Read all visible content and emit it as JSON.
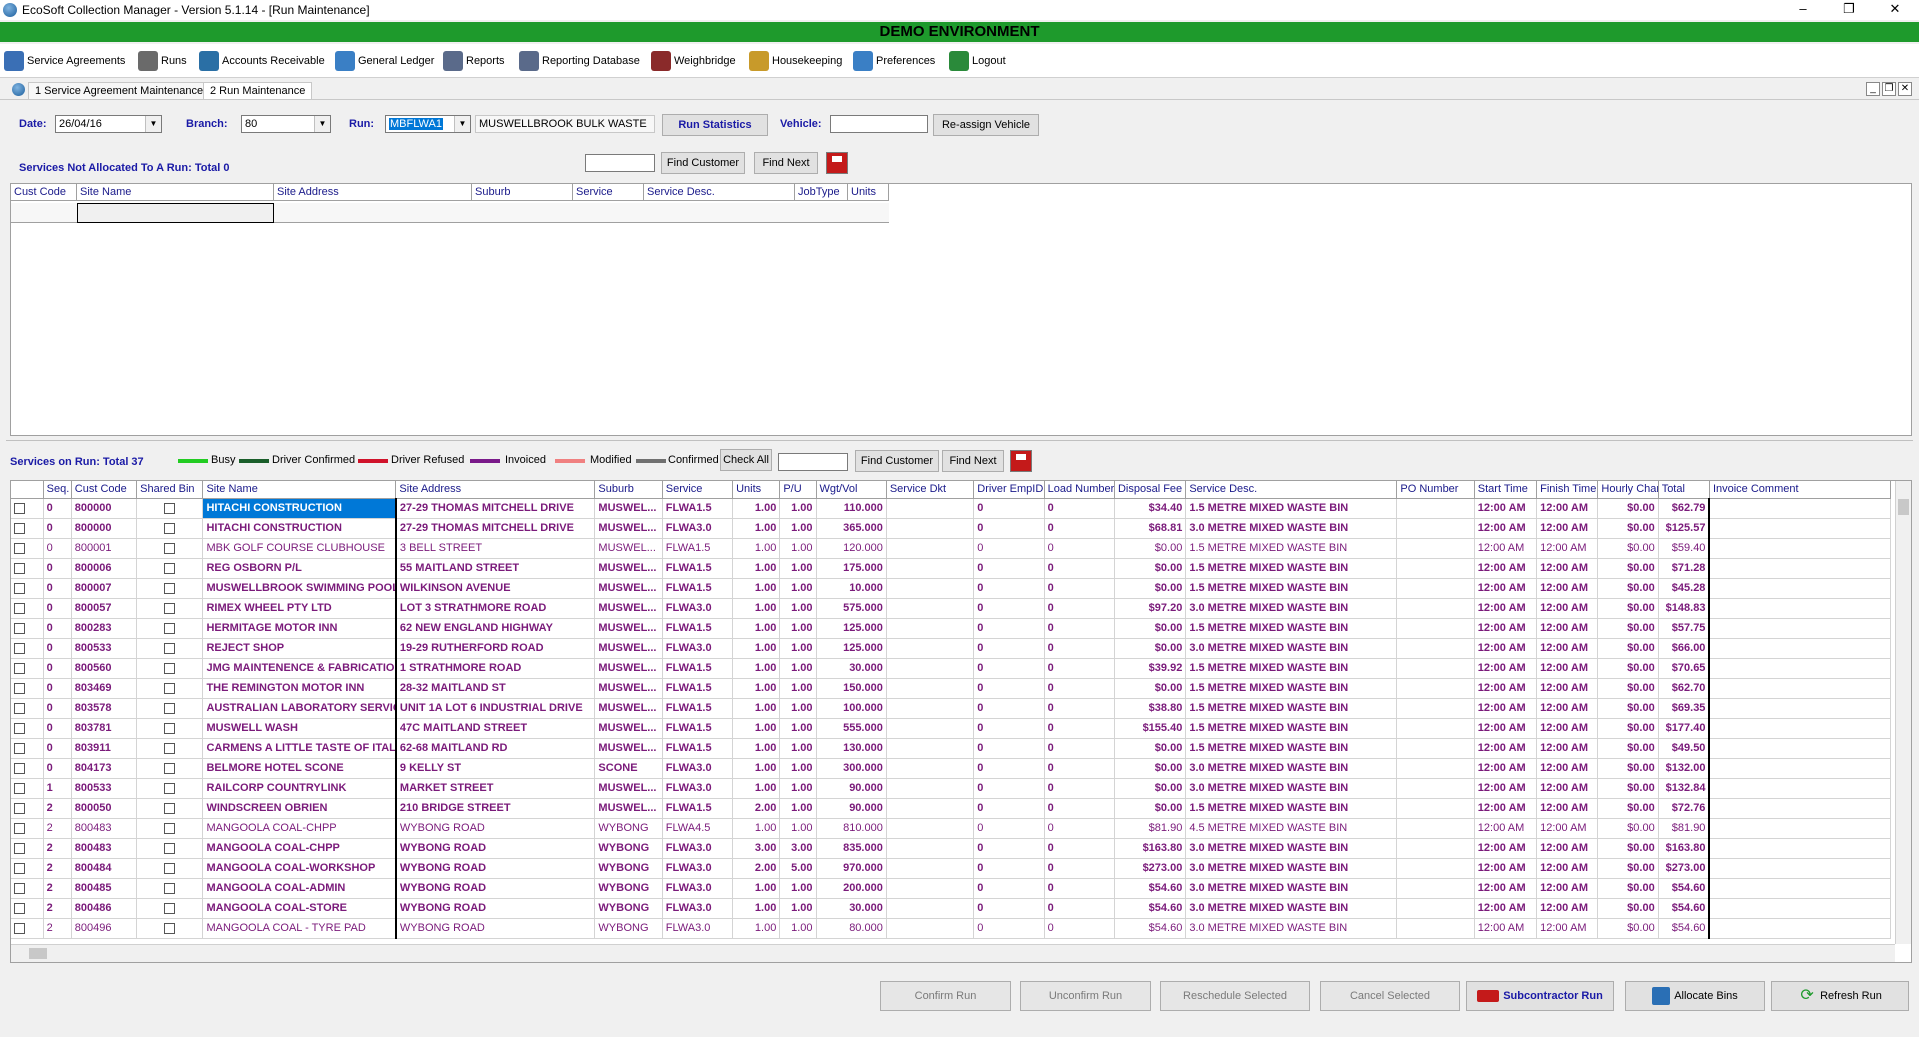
{
  "window": {
    "title": "EcoSoft Collection Manager - Version 5.1.14 - [Run Maintenance]",
    "banner": "DEMO ENVIRONMENT"
  },
  "menu": [
    {
      "label": "Service Agreements",
      "icon": "service-agreements-icon"
    },
    {
      "label": "Runs",
      "icon": "runs-icon"
    },
    {
      "label": "Accounts Receivable",
      "icon": "accounts-receivable-icon"
    },
    {
      "label": "General Ledger",
      "icon": "general-ledger-icon"
    },
    {
      "label": "Reports",
      "icon": "reports-icon"
    },
    {
      "label": "Reporting Database",
      "icon": "reporting-database-icon"
    },
    {
      "label": "Weighbridge",
      "icon": "weighbridge-icon"
    },
    {
      "label": "Housekeeping",
      "icon": "housekeeping-icon"
    },
    {
      "label": "Preferences",
      "icon": "preferences-icon"
    },
    {
      "label": "Logout",
      "icon": "logout-icon"
    }
  ],
  "tabs": [
    "1 Service Agreement Maintenance",
    "2 Run Maintenance"
  ],
  "filters": {
    "date_label": "Date:",
    "date_value": "26/04/16",
    "branch_label": "Branch:",
    "branch_value": "80",
    "run_label": "Run:",
    "run_value": "MBFLWA1",
    "run_desc": "MUSWELLBROOK BULK WASTE",
    "run_stats_label": "Run Statistics",
    "vehicle_label": "Vehicle:",
    "vehicle_value": "",
    "reassign_label": "Re-assign Vehicle"
  },
  "unallocated": {
    "title": "Services Not Allocated To A Run: Total 0",
    "find_customer": "Find Customer",
    "find_next": "Find Next",
    "search_value": "",
    "columns": [
      "Cust Code",
      "Site Name",
      "Site Address",
      "Suburb",
      "Service",
      "Service Desc.",
      "JobType",
      "Units"
    ]
  },
  "on_run": {
    "title": "Services on Run: Total 37",
    "legend": [
      {
        "label": "Busy",
        "color": "#22cc22"
      },
      {
        "label": "Driver Confirmed",
        "color": "#1a5e2a"
      },
      {
        "label": "Driver Refused",
        "color": "#d0122a"
      },
      {
        "label": "Invoiced",
        "color": "#7a1a8a"
      },
      {
        "label": "Modified",
        "color": "#f08080"
      },
      {
        "label": "Confirmed",
        "color": "#707070"
      }
    ],
    "check_all": "Check All",
    "find_customer": "Find Customer",
    "find_next": "Find Next",
    "search_value": "",
    "columns": [
      "Seq.",
      "Cust Code",
      "Shared Bin",
      "Site Name",
      "Site Address",
      "Suburb",
      "Service",
      "Units",
      "P/U",
      "Wgt/Vol",
      "Service Dkt",
      "Driver EmpID",
      "Load Number",
      "Disposal Fee",
      "Service Desc.",
      "PO Number",
      "Start Time",
      "Finish Time",
      "Hourly Charge",
      "Total",
      "Invoice Comment"
    ],
    "rows": [
      {
        "seq": "0",
        "code": "800000",
        "name": "HITACHI CONSTRUCTION",
        "addr": "27-29 THOMAS MITCHELL DRIVE",
        "suburb": "MUSWEL...",
        "service": "FLWA1.5",
        "units": "1.00",
        "pu": "1.00",
        "wgt": "110.000",
        "dkt": "",
        "emp": "0",
        "load": "0",
        "fee": "$34.40",
        "desc": "1.5 METRE MIXED WASTE BIN",
        "po": "",
        "start": "12:00 AM",
        "finish": "12:00 AM",
        "hourly": "$0.00",
        "total": "$62.79",
        "comment": "",
        "bold": true,
        "selected": true
      },
      {
        "seq": "0",
        "code": "800000",
        "name": "HITACHI CONSTRUCTION",
        "addr": "27-29 THOMAS MITCHELL DRIVE",
        "suburb": "MUSWEL...",
        "service": "FLWA3.0",
        "units": "1.00",
        "pu": "1.00",
        "wgt": "365.000",
        "dkt": "",
        "emp": "0",
        "load": "0",
        "fee": "$68.81",
        "desc": "3.0 METRE MIXED WASTE BIN",
        "po": "",
        "start": "12:00 AM",
        "finish": "12:00 AM",
        "hourly": "$0.00",
        "total": "$125.57",
        "comment": "",
        "bold": true
      },
      {
        "seq": "0",
        "code": "800001",
        "name": "MBK GOLF COURSE CLUBHOUSE",
        "addr": "3 BELL STREET",
        "suburb": "MUSWEL...",
        "service": "FLWA1.5",
        "units": "1.00",
        "pu": "1.00",
        "wgt": "120.000",
        "dkt": "",
        "emp": "0",
        "load": "0",
        "fee": "$0.00",
        "desc": "1.5 METRE MIXED WASTE BIN",
        "po": "",
        "start": "12:00 AM",
        "finish": "12:00 AM",
        "hourly": "$0.00",
        "total": "$59.40",
        "comment": "",
        "bold": false
      },
      {
        "seq": "0",
        "code": "800006",
        "name": "REG OSBORN P/L",
        "addr": "55 MAITLAND STREET",
        "suburb": "MUSWEL...",
        "service": "FLWA1.5",
        "units": "1.00",
        "pu": "1.00",
        "wgt": "175.000",
        "dkt": "",
        "emp": "0",
        "load": "0",
        "fee": "$0.00",
        "desc": "1.5 METRE MIXED WASTE BIN",
        "po": "",
        "start": "12:00 AM",
        "finish": "12:00 AM",
        "hourly": "$0.00",
        "total": "$71.28",
        "comment": "",
        "bold": true
      },
      {
        "seq": "0",
        "code": "800007",
        "name": "MUSWELLBROOK SWIMMING POOL",
        "addr": "WILKINSON AVENUE",
        "suburb": "MUSWEL...",
        "service": "FLWA1.5",
        "units": "1.00",
        "pu": "1.00",
        "wgt": "10.000",
        "dkt": "",
        "emp": "0",
        "load": "0",
        "fee": "$0.00",
        "desc": "1.5 METRE MIXED WASTE BIN",
        "po": "",
        "start": "12:00 AM",
        "finish": "12:00 AM",
        "hourly": "$0.00",
        "total": "$45.28",
        "comment": "",
        "bold": true
      },
      {
        "seq": "0",
        "code": "800057",
        "name": "RIMEX WHEEL PTY LTD",
        "addr": "LOT 3 STRATHMORE ROAD",
        "suburb": "MUSWEL...",
        "service": "FLWA3.0",
        "units": "1.00",
        "pu": "1.00",
        "wgt": "575.000",
        "dkt": "",
        "emp": "0",
        "load": "0",
        "fee": "$97.20",
        "desc": "3.0 METRE MIXED WASTE BIN",
        "po": "",
        "start": "12:00 AM",
        "finish": "12:00 AM",
        "hourly": "$0.00",
        "total": "$148.83",
        "comment": "",
        "bold": true
      },
      {
        "seq": "0",
        "code": "800283",
        "name": "HERMITAGE MOTOR INN",
        "addr": "62 NEW ENGLAND HIGHWAY",
        "suburb": "MUSWEL...",
        "service": "FLWA1.5",
        "units": "1.00",
        "pu": "1.00",
        "wgt": "125.000",
        "dkt": "",
        "emp": "0",
        "load": "0",
        "fee": "$0.00",
        "desc": "1.5 METRE MIXED WASTE BIN",
        "po": "",
        "start": "12:00 AM",
        "finish": "12:00 AM",
        "hourly": "$0.00",
        "total": "$57.75",
        "comment": "",
        "bold": true
      },
      {
        "seq": "0",
        "code": "800533",
        "name": "REJECT SHOP",
        "addr": "19-29 RUTHERFORD ROAD",
        "suburb": "MUSWEL...",
        "service": "FLWA3.0",
        "units": "1.00",
        "pu": "1.00",
        "wgt": "125.000",
        "dkt": "",
        "emp": "0",
        "load": "0",
        "fee": "$0.00",
        "desc": "3.0 METRE MIXED WASTE BIN",
        "po": "",
        "start": "12:00 AM",
        "finish": "12:00 AM",
        "hourly": "$0.00",
        "total": "$66.00",
        "comment": "",
        "bold": true
      },
      {
        "seq": "0",
        "code": "800560",
        "name": "JMG MAINTENENCE & FABRICATIO",
        "addr": "1 STRATHMORE ROAD",
        "suburb": "MUSWEL...",
        "service": "FLWA1.5",
        "units": "1.00",
        "pu": "1.00",
        "wgt": "30.000",
        "dkt": "",
        "emp": "0",
        "load": "0",
        "fee": "$39.92",
        "desc": "1.5 METRE MIXED WASTE BIN",
        "po": "",
        "start": "12:00 AM",
        "finish": "12:00 AM",
        "hourly": "$0.00",
        "total": "$70.65",
        "comment": "",
        "bold": true
      },
      {
        "seq": "0",
        "code": "803469",
        "name": "THE REMINGTON MOTOR INN",
        "addr": "28-32 MAITLAND ST",
        "suburb": "MUSWEL...",
        "service": "FLWA1.5",
        "units": "1.00",
        "pu": "1.00",
        "wgt": "150.000",
        "dkt": "",
        "emp": "0",
        "load": "0",
        "fee": "$0.00",
        "desc": "1.5 METRE MIXED WASTE BIN",
        "po": "",
        "start": "12:00 AM",
        "finish": "12:00 AM",
        "hourly": "$0.00",
        "total": "$62.70",
        "comment": "",
        "bold": true
      },
      {
        "seq": "0",
        "code": "803578",
        "name": "AUSTRALIAN LABORATORY SERVIC",
        "addr": "UNIT 1A LOT 6 INDUSTRIAL DRIVE",
        "suburb": "MUSWEL...",
        "service": "FLWA1.5",
        "units": "1.00",
        "pu": "1.00",
        "wgt": "100.000",
        "dkt": "",
        "emp": "0",
        "load": "0",
        "fee": "$38.80",
        "desc": "1.5 METRE MIXED WASTE BIN",
        "po": "",
        "start": "12:00 AM",
        "finish": "12:00 AM",
        "hourly": "$0.00",
        "total": "$69.35",
        "comment": "",
        "bold": true
      },
      {
        "seq": "0",
        "code": "803781",
        "name": "MUSWELL WASH",
        "addr": "47C MAITLAND  STREET",
        "suburb": "MUSWEL...",
        "service": "FLWA1.5",
        "units": "1.00",
        "pu": "1.00",
        "wgt": "555.000",
        "dkt": "",
        "emp": "0",
        "load": "0",
        "fee": "$155.40",
        "desc": "1.5 METRE MIXED WASTE BIN",
        "po": "",
        "start": "12:00 AM",
        "finish": "12:00 AM",
        "hourly": "$0.00",
        "total": "$177.40",
        "comment": "",
        "bold": true
      },
      {
        "seq": "0",
        "code": "803911",
        "name": "CARMENS A LITTLE TASTE OF ITAL",
        "addr": "62-68 MAITLAND RD",
        "suburb": "MUSWEL...",
        "service": "FLWA1.5",
        "units": "1.00",
        "pu": "1.00",
        "wgt": "130.000",
        "dkt": "",
        "emp": "0",
        "load": "0",
        "fee": "$0.00",
        "desc": "1.5 METRE MIXED WASTE BIN",
        "po": "",
        "start": "12:00 AM",
        "finish": "12:00 AM",
        "hourly": "$0.00",
        "total": "$49.50",
        "comment": "",
        "bold": true
      },
      {
        "seq": "0",
        "code": "804173",
        "name": "BELMORE HOTEL SCONE",
        "addr": "9 KELLY ST",
        "suburb": "SCONE",
        "service": "FLWA3.0",
        "units": "1.00",
        "pu": "1.00",
        "wgt": "300.000",
        "dkt": "",
        "emp": "0",
        "load": "0",
        "fee": "$0.00",
        "desc": "3.0 METRE MIXED WASTE BIN",
        "po": "",
        "start": "12:00 AM",
        "finish": "12:00 AM",
        "hourly": "$0.00",
        "total": "$132.00",
        "comment": "",
        "bold": true
      },
      {
        "seq": "1",
        "code": "800533",
        "name": "RAILCORP COUNTRYLINK",
        "addr": "MARKET STREET",
        "suburb": "MUSWEL...",
        "service": "FLWA3.0",
        "units": "1.00",
        "pu": "1.00",
        "wgt": "90.000",
        "dkt": "",
        "emp": "0",
        "load": "0",
        "fee": "$0.00",
        "desc": "3.0 METRE MIXED WASTE BIN",
        "po": "",
        "start": "12:00 AM",
        "finish": "12:00 AM",
        "hourly": "$0.00",
        "total": "$132.84",
        "comment": "",
        "bold": true
      },
      {
        "seq": "2",
        "code": "800050",
        "name": "WINDSCREEN OBRIEN",
        "addr": "210 BRIDGE STREET",
        "suburb": "MUSWEL...",
        "service": "FLWA1.5",
        "units": "2.00",
        "pu": "1.00",
        "wgt": "90.000",
        "dkt": "",
        "emp": "0",
        "load": "0",
        "fee": "$0.00",
        "desc": "1.5 METRE MIXED WASTE BIN",
        "po": "",
        "start": "12:00 AM",
        "finish": "12:00 AM",
        "hourly": "$0.00",
        "total": "$72.76",
        "comment": "",
        "bold": true
      },
      {
        "seq": "2",
        "code": "800483",
        "name": "MANGOOLA COAL-CHPP",
        "addr": "WYBONG ROAD",
        "suburb": "WYBONG",
        "service": "FLWA4.5",
        "units": "1.00",
        "pu": "1.00",
        "wgt": "810.000",
        "dkt": "",
        "emp": "0",
        "load": "0",
        "fee": "$81.90",
        "desc": "4.5 METRE MIXED WASTE BIN",
        "po": "",
        "start": "12:00 AM",
        "finish": "12:00 AM",
        "hourly": "$0.00",
        "total": "$81.90",
        "comment": "",
        "bold": false
      },
      {
        "seq": "2",
        "code": "800483",
        "name": "MANGOOLA COAL-CHPP",
        "addr": "WYBONG ROAD",
        "suburb": "WYBONG",
        "service": "FLWA3.0",
        "units": "3.00",
        "pu": "3.00",
        "wgt": "835.000",
        "dkt": "",
        "emp": "0",
        "load": "0",
        "fee": "$163.80",
        "desc": "3.0 METRE MIXED WASTE BIN",
        "po": "",
        "start": "12:00 AM",
        "finish": "12:00 AM",
        "hourly": "$0.00",
        "total": "$163.80",
        "comment": "",
        "bold": true
      },
      {
        "seq": "2",
        "code": "800484",
        "name": "MANGOOLA COAL-WORKSHOP",
        "addr": "WYBONG ROAD",
        "suburb": "WYBONG",
        "service": "FLWA3.0",
        "units": "2.00",
        "pu": "5.00",
        "wgt": "970.000",
        "dkt": "",
        "emp": "0",
        "load": "0",
        "fee": "$273.00",
        "desc": "3.0 METRE MIXED WASTE BIN",
        "po": "",
        "start": "12:00 AM",
        "finish": "12:00 AM",
        "hourly": "$0.00",
        "total": "$273.00",
        "comment": "",
        "bold": true
      },
      {
        "seq": "2",
        "code": "800485",
        "name": "MANGOOLA COAL-ADMIN",
        "addr": "WYBONG ROAD",
        "suburb": "WYBONG",
        "service": "FLWA3.0",
        "units": "1.00",
        "pu": "1.00",
        "wgt": "200.000",
        "dkt": "",
        "emp": "0",
        "load": "0",
        "fee": "$54.60",
        "desc": "3.0 METRE MIXED WASTE BIN",
        "po": "",
        "start": "12:00 AM",
        "finish": "12:00 AM",
        "hourly": "$0.00",
        "total": "$54.60",
        "comment": "",
        "bold": true
      },
      {
        "seq": "2",
        "code": "800486",
        "name": "MANGOOLA COAL-STORE",
        "addr": "WYBONG ROAD",
        "suburb": "WYBONG",
        "service": "FLWA3.0",
        "units": "1.00",
        "pu": "1.00",
        "wgt": "30.000",
        "dkt": "",
        "emp": "0",
        "load": "0",
        "fee": "$54.60",
        "desc": "3.0 METRE MIXED WASTE BIN",
        "po": "",
        "start": "12:00 AM",
        "finish": "12:00 AM",
        "hourly": "$0.00",
        "total": "$54.60",
        "comment": "",
        "bold": true
      },
      {
        "seq": "2",
        "code": "800496",
        "name": "MANGOOLA COAL - TYRE PAD",
        "addr": "WYBONG ROAD",
        "suburb": "WYBONG",
        "service": "FLWA3.0",
        "units": "1.00",
        "pu": "1.00",
        "wgt": "80.000",
        "dkt": "",
        "emp": "0",
        "load": "0",
        "fee": "$54.60",
        "desc": "3.0 METRE MIXED WASTE BIN",
        "po": "",
        "start": "12:00 AM",
        "finish": "12:00 AM",
        "hourly": "$0.00",
        "total": "$54.60",
        "comment": "",
        "bold": false
      }
    ]
  },
  "bottom_buttons": [
    {
      "label": "Confirm Run",
      "enabled": false
    },
    {
      "label": "Unconfirm Run",
      "enabled": false
    },
    {
      "label": "Reschedule Selected",
      "enabled": false
    },
    {
      "label": "Cancel Selected",
      "enabled": false
    },
    {
      "label": "Subcontractor Run",
      "enabled": true,
      "icon": "truck-icon"
    },
    {
      "label": "Allocate Bins",
      "enabled": true,
      "icon": "allocate-bins-icon"
    },
    {
      "label": "Refresh Run",
      "enabled": true,
      "icon": "refresh-icon"
    }
  ]
}
